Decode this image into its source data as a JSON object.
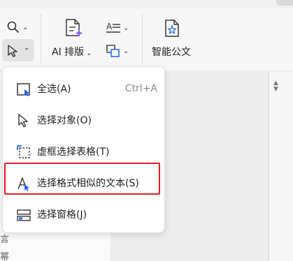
{
  "ribbon": {
    "ai_layout_label": "AI 排版",
    "smart_doc_label": "智能公文"
  },
  "menu": {
    "items": [
      {
        "label": "全选(A)",
        "shortcut": "Ctrl+A",
        "icon": "select-all-icon"
      },
      {
        "label": "选择对象(O)",
        "shortcut": "",
        "icon": "cursor-arrow-icon"
      },
      {
        "label": "虚框选择表格(T)",
        "shortcut": "",
        "icon": "dashed-table-select-icon"
      },
      {
        "label": "选择格式相似的文本(S)",
        "shortcut": "",
        "icon": "similar-format-text-icon"
      },
      {
        "label": "选择窗格(J)",
        "shortcut": "",
        "icon": "selection-pane-icon"
      }
    ]
  },
  "left_fragments": [
    "言",
    "幂"
  ],
  "colors": {
    "accent": "#1a66ff",
    "highlight": "#e5201d",
    "menu_bg": "#ffffff"
  }
}
